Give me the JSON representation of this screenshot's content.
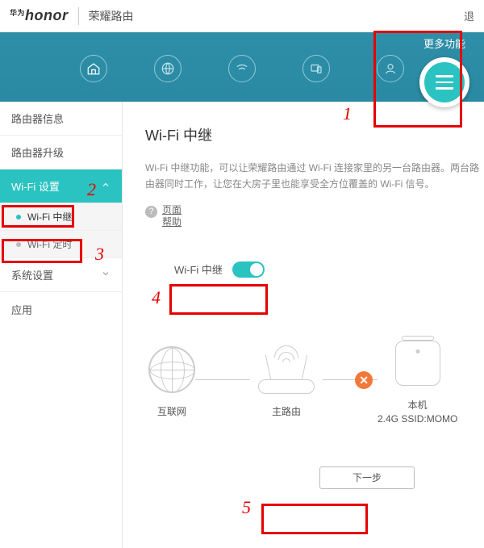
{
  "header": {
    "logo_prefix": "华为",
    "logo": "honor",
    "product_name": "荣耀路由",
    "logout": "退"
  },
  "nav": {
    "icons": [
      "home",
      "globe",
      "wifi",
      "devices",
      "user"
    ],
    "more_label": "更多功能"
  },
  "sidebar": {
    "items": [
      {
        "label": "路由器信息"
      },
      {
        "label": "路由器升级"
      },
      {
        "label": "Wi-Fi 设置",
        "active": true,
        "expanded": true
      },
      {
        "label": "系统设置"
      },
      {
        "label": "应用"
      }
    ],
    "wifi_sub": [
      {
        "label": "Wi-Fi 中继",
        "active": true
      },
      {
        "label": "Wi-Fi 定时"
      }
    ]
  },
  "content": {
    "title": "Wi-Fi 中继",
    "desc": "Wi-Fi 中继功能，可以让荣耀路由通过 Wi-Fi 连接家里的另一台路由器。两台路由器同时工作，让您在大房子里也能享受全方位覆盖的 Wi-Fi 信号。",
    "help_link": "页面帮助",
    "toggle_label": "Wi-Fi 中继",
    "toggle_on": true,
    "devices": {
      "internet": "互联网",
      "main_router": "主路由",
      "local": "本机",
      "local_ssid": "2.4G SSID:MOMO"
    },
    "next_button": "下一步"
  },
  "annotations": {
    "n1": "1",
    "n2": "2",
    "n3": "3",
    "n4": "4",
    "n5": "5"
  }
}
